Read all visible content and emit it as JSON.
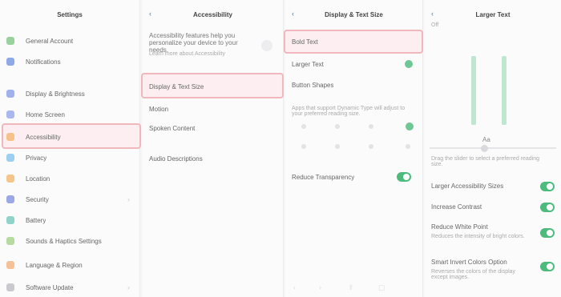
{
  "panel1": {
    "title": "Settings",
    "subtitle": "",
    "items": [
      {
        "label": "General Account",
        "color": "#9ad29e"
      },
      {
        "label": "Notifications",
        "color": "#8fa9e6"
      },
      {
        "label": "Display & Brightness",
        "color": "#9fb2ee"
      },
      {
        "label": "Home Screen",
        "color": "#a9b9ef"
      },
      {
        "label": "Accessibility",
        "color": "#f7c18a"
      },
      {
        "label": "Privacy",
        "color": "#9cd0f2"
      },
      {
        "label": "Location",
        "color": "#f5c58c"
      },
      {
        "label": "Security",
        "color": "#9aa8e8"
      },
      {
        "label": "Battery",
        "color": "#8fd3c9"
      },
      {
        "label": "Sounds & Haptics Settings",
        "color": "#b6dba0"
      },
      {
        "label": "Language & Region",
        "color": "#f7c196"
      },
      {
        "label": "Software Update",
        "color": "#c9c9cf"
      }
    ]
  },
  "panel2": {
    "title": "Accessibility",
    "intro": "Accessibility features help you personalize your device to your needs.",
    "intro2": "Learn more about Accessibility",
    "items": [
      {
        "label": "Display & Text Size"
      },
      {
        "label": "Motion"
      },
      {
        "label": "Spoken Content"
      },
      {
        "label": "Audio Descriptions"
      }
    ]
  },
  "panel3": {
    "title": "Display & Text Size",
    "items": [
      {
        "label": "Bold Text"
      },
      {
        "label": "Larger Text"
      },
      {
        "label": "Button Shapes"
      }
    ],
    "note": "Apps that support Dynamic Type will adjust to your preferred reading size.",
    "toggle_label": "Reduce Transparency",
    "footer_icons": [
      "back-icon",
      "forward-icon",
      "share-icon",
      "bookmark-icon"
    ]
  },
  "panel4": {
    "title": "Larger Text",
    "side_label": "Off",
    "slider_value_label": "Aa",
    "slider_caption": "Drag the slider to select a preferred reading size.",
    "options": [
      {
        "label": "Larger Accessibility Sizes",
        "on": true
      },
      {
        "label": "Increase Contrast",
        "on": true
      },
      {
        "label": "Reduce White Point",
        "on": true,
        "sub": "Reduces the intensity of bright colors."
      },
      {
        "label": "Smart Invert Colors Option",
        "on": true,
        "sub": "Reverses the colors of the display except images."
      }
    ]
  }
}
